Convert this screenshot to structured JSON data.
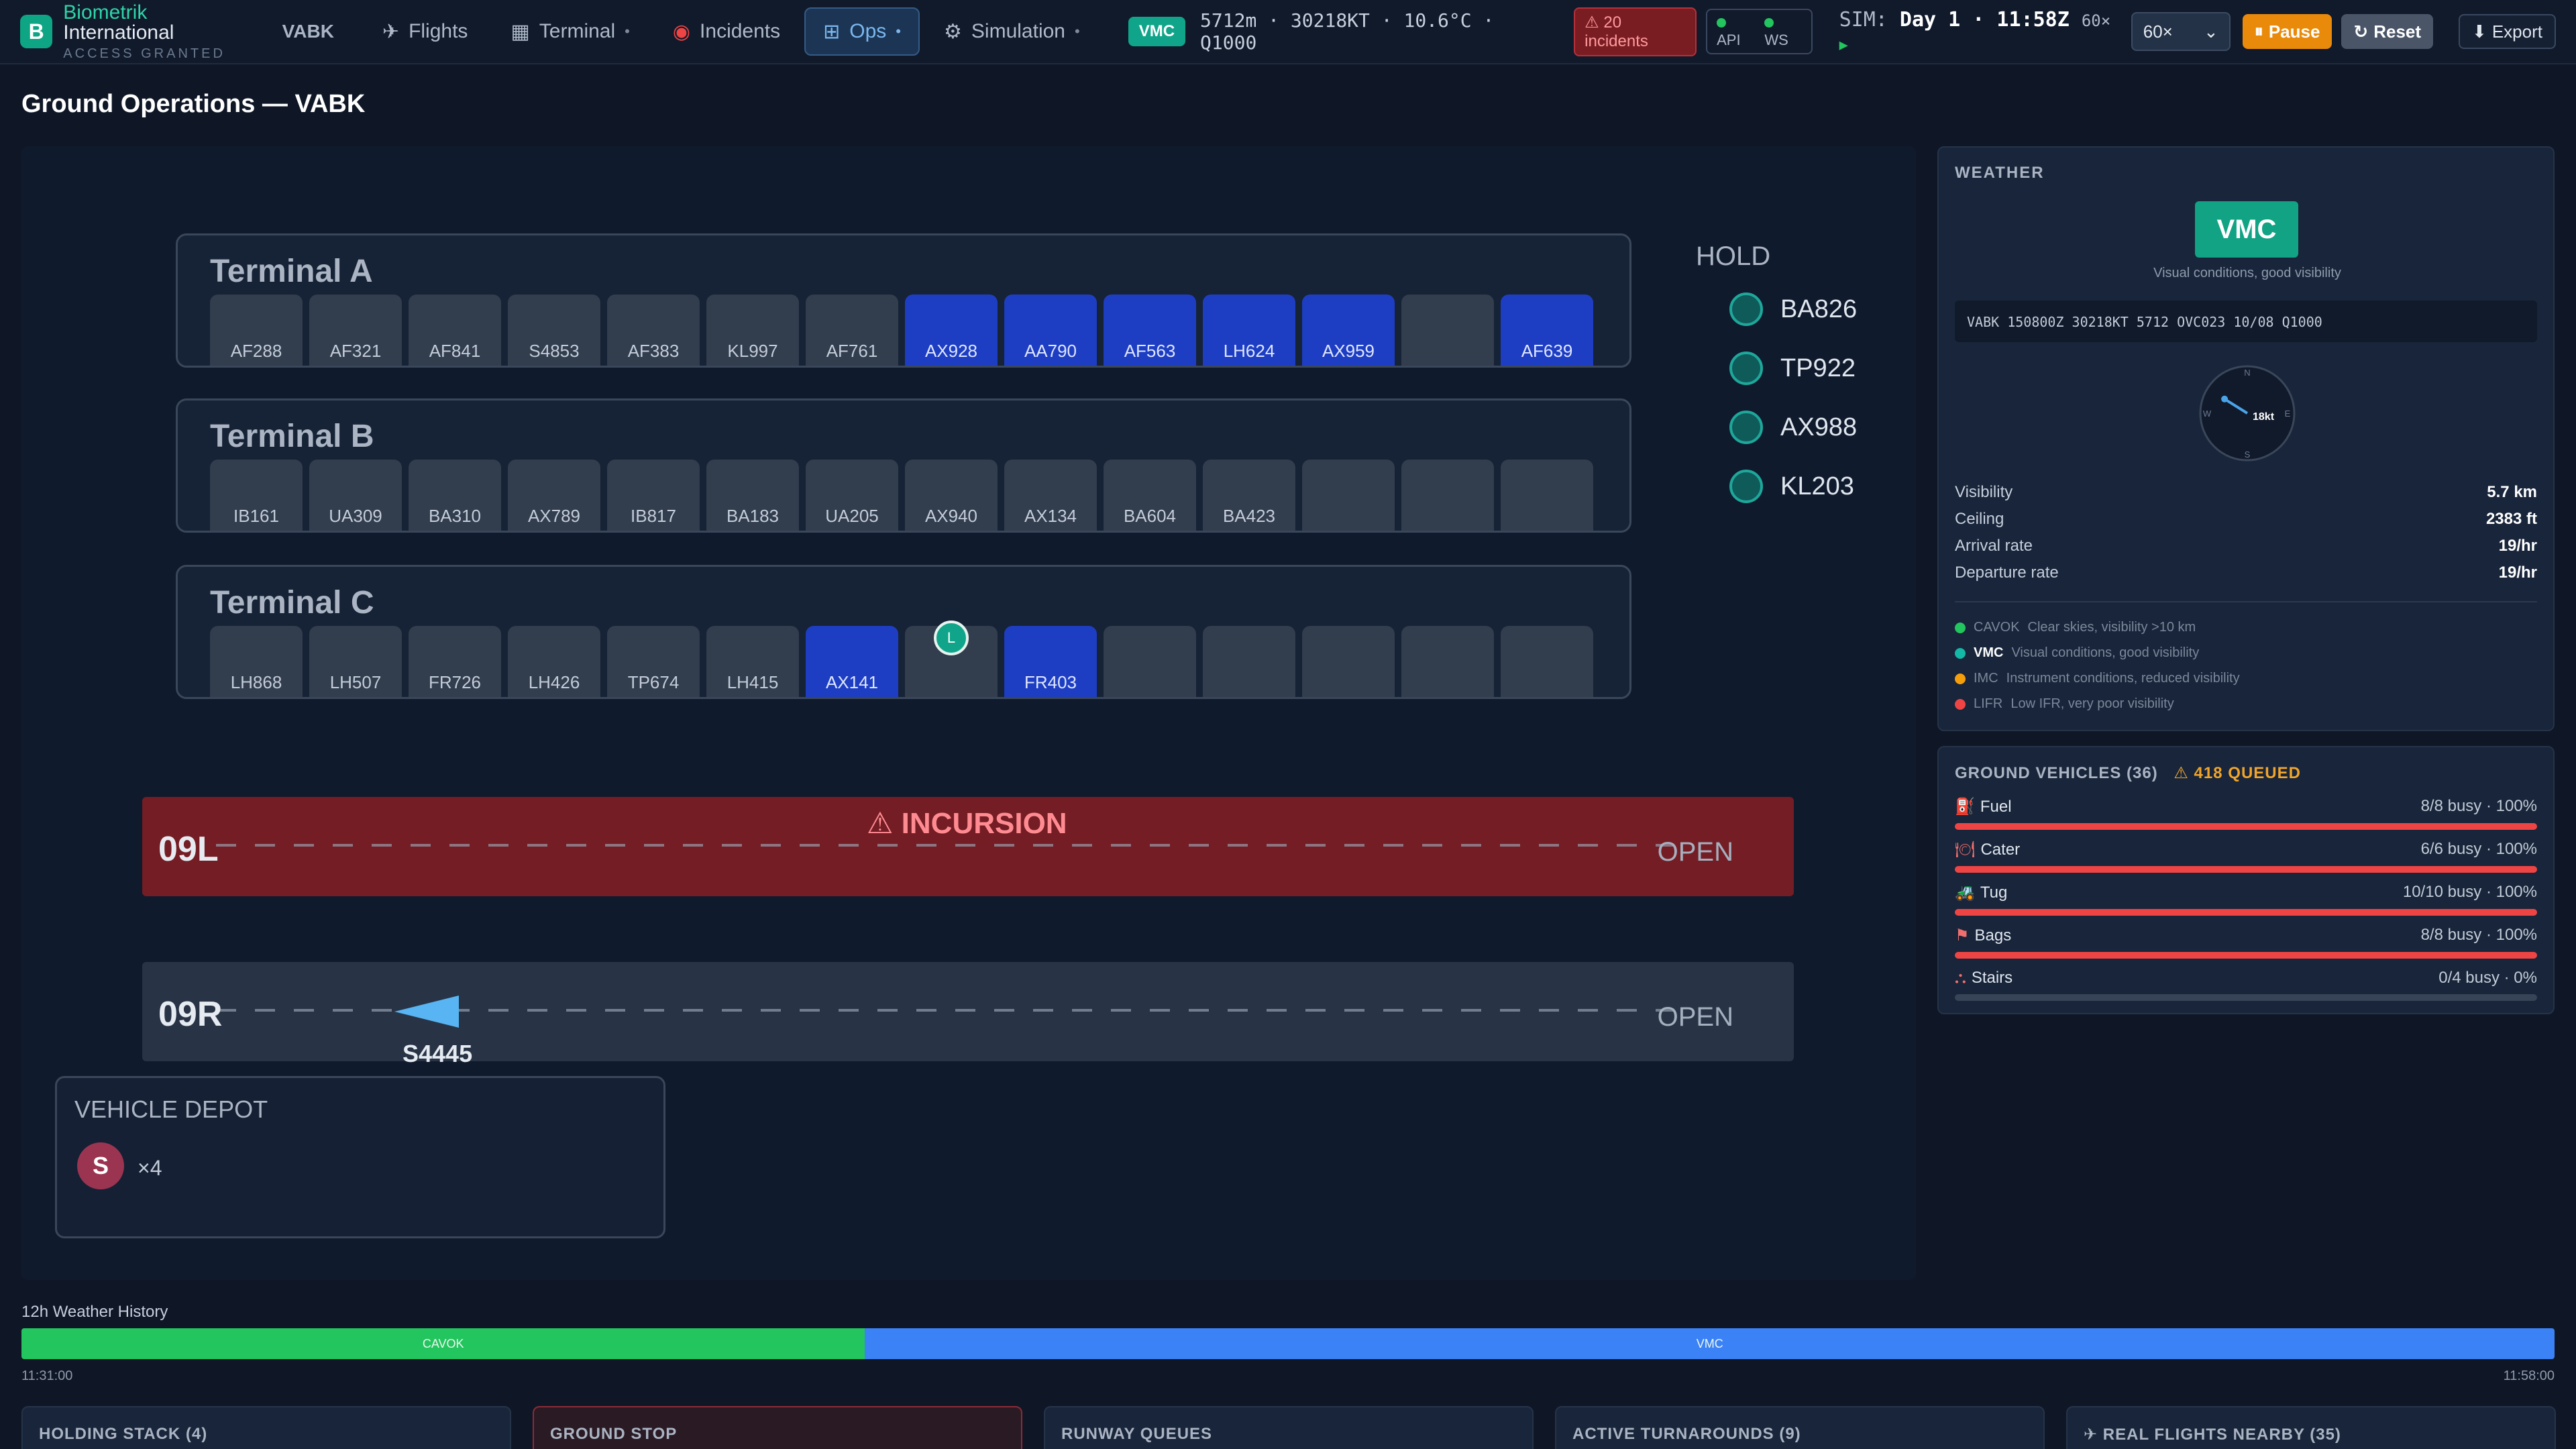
{
  "app": {
    "logo_letter": "B",
    "brand_accent": "Biometrik",
    "brand_rest": " International",
    "brand_sub": "ACCESS GRANTED",
    "airport": "VABK"
  },
  "nav": [
    {
      "label": "Flights",
      "icon": "airplane-icon",
      "dot": ""
    },
    {
      "label": "Terminal",
      "icon": "building-icon",
      "dot": "•"
    },
    {
      "label": "Incidents",
      "icon": "siren-icon",
      "dot": ""
    },
    {
      "label": "Ops",
      "icon": "grid-icon",
      "dot": "•",
      "active": true
    },
    {
      "label": "Simulation",
      "icon": "gear-icon",
      "dot": "•"
    }
  ],
  "status": {
    "flight_rules": "VMC",
    "metar_short": "5712m · 30218KT · 10.6°C · Q1000",
    "incidents": "⚠ 20 incidents",
    "api": "API",
    "ws": "WS",
    "sim_prefix": "SIM:",
    "sim_day": "Day 1",
    "sim_time": "11:58Z",
    "sim_speed": "60×",
    "speed_select": "60×",
    "pause": "Pause",
    "reset": "Reset",
    "export": "Export"
  },
  "page_title": "Ground Operations — VABK",
  "terminals": [
    {
      "name": "Terminal A",
      "gates": [
        {
          "label": "AF288"
        },
        {
          "label": "AF321"
        },
        {
          "label": "AF841"
        },
        {
          "label": "S4853"
        },
        {
          "label": "AF383"
        },
        {
          "label": "KL997"
        },
        {
          "label": "AF761"
        },
        {
          "label": "AX928",
          "occupied": true
        },
        {
          "label": "AA790",
          "occupied": true
        },
        {
          "label": "AF563",
          "occupied": true
        },
        {
          "label": "LH624",
          "occupied": true
        },
        {
          "label": "AX959",
          "occupied": true
        },
        {
          "label": ""
        },
        {
          "label": "AF639",
          "occupied": true
        }
      ]
    },
    {
      "name": "Terminal B",
      "gates": [
        {
          "label": "IB161"
        },
        {
          "label": "UA309"
        },
        {
          "label": "BA310"
        },
        {
          "label": "AX789"
        },
        {
          "label": "IB817"
        },
        {
          "label": "BA183"
        },
        {
          "label": "UA205"
        },
        {
          "label": "AX940"
        },
        {
          "label": "AX134"
        },
        {
          "label": "BA604"
        },
        {
          "label": "BA423"
        },
        {
          "label": ""
        },
        {
          "label": ""
        },
        {
          "label": ""
        }
      ]
    },
    {
      "name": "Terminal C",
      "gates": [
        {
          "label": "LH868"
        },
        {
          "label": "LH507"
        },
        {
          "label": "FR726"
        },
        {
          "label": "LH426"
        },
        {
          "label": "TP674"
        },
        {
          "label": "LH415"
        },
        {
          "label": "AX141",
          "occupied": true
        },
        {
          "label": "",
          "vehicle": "L"
        },
        {
          "label": "FR403",
          "occupied": true
        },
        {
          "label": ""
        },
        {
          "label": ""
        },
        {
          "label": ""
        },
        {
          "label": ""
        },
        {
          "label": ""
        }
      ]
    }
  ],
  "hold": {
    "title": "HOLD",
    "flights": [
      "BA826",
      "TP922",
      "AX988",
      "KL203"
    ]
  },
  "runways": [
    {
      "name": "09L",
      "status": "OPEN",
      "alert": "⚠ INCURSION"
    },
    {
      "name": "09R",
      "status": "OPEN",
      "aircraft": "S4445"
    }
  ],
  "depot": {
    "title": "VEHICLE DEPOT",
    "vehicle_letter": "S",
    "count": "×4"
  },
  "weather": {
    "title": "WEATHER",
    "category": "VMC",
    "category_desc": "Visual conditions, good visibility",
    "metar": "VABK 150800Z 30218KT 5712 OVC023 10/08 Q1000",
    "wind_label": "18kt",
    "wind_dir_deg": 302,
    "compass": {
      "n": "N",
      "e": "E",
      "s": "S",
      "w": "W"
    },
    "rows": [
      {
        "label": "Visibility",
        "value": "5.7 km"
      },
      {
        "label": "Ceiling",
        "value": "2383 ft"
      },
      {
        "label": "Arrival rate",
        "value": "19/hr"
      },
      {
        "label": "Departure rate",
        "value": "19/hr"
      }
    ],
    "legend": [
      {
        "cat": "CAVOK",
        "desc": "Clear skies, visibility >10 km",
        "color": "#22c55e"
      },
      {
        "cat": "VMC",
        "desc": "Visual conditions, good visibility",
        "color": "#14b8a6",
        "active": true
      },
      {
        "cat": "IMC",
        "desc": "Instrument conditions, reduced visibility",
        "color": "#f59e0b"
      },
      {
        "cat": "LIFR",
        "desc": "Low IFR, very poor visibility",
        "color": "#ef4444"
      }
    ]
  },
  "vehicles": {
    "title": "GROUND VEHICLES (36)",
    "queued": "⚠ 418 QUEUED",
    "rows": [
      {
        "name": "Fuel",
        "icon": "fuel-pump-icon",
        "glyph": "⛽",
        "busy": "8/8 busy · 100%",
        "fill": 100
      },
      {
        "name": "Cater",
        "icon": "catering-icon",
        "glyph": "🍽",
        "busy": "6/6 busy · 100%",
        "fill": 100
      },
      {
        "name": "Tug",
        "icon": "tug-icon",
        "glyph": "🚜",
        "busy": "10/10 busy · 100%",
        "fill": 100
      },
      {
        "name": "Bags",
        "icon": "baggage-icon",
        "glyph": "⚑",
        "busy": "8/8 busy · 100%",
        "fill": 100
      },
      {
        "name": "Stairs",
        "icon": "stairs-icon",
        "glyph": "⛬",
        "busy": "0/4 busy · 0%",
        "fill": 0
      }
    ]
  },
  "history": {
    "title": "12h Weather History",
    "segments": [
      {
        "label": "CAVOK",
        "color": "#22c55e",
        "share": 0.333
      },
      {
        "label": "VMC",
        "color": "#3b82f6",
        "share": 0.667
      }
    ],
    "start": "11:31:00",
    "end": "11:58:00"
  },
  "bottom_panels": [
    {
      "label": "HOLDING STACK (4)"
    },
    {
      "label": "GROUND STOP",
      "alert": true
    },
    {
      "label": "RUNWAY QUEUES"
    },
    {
      "label": "ACTIVE TURNAROUNDS (9)"
    },
    {
      "label": "✈ REAL FLIGHTS NEARBY (35)"
    }
  ]
}
